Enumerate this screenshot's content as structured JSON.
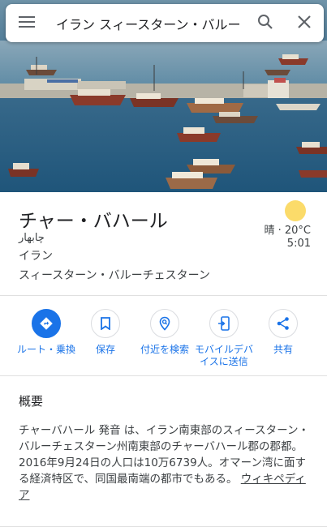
{
  "search": {
    "query": "イラン スィースターン・バルー"
  },
  "place": {
    "title": "チャー・バハール",
    "native_name": "چابهار",
    "country": "イラン",
    "region": "スィースターン・バルーチェスターン"
  },
  "weather": {
    "condition_temp": "晴 · 20°C",
    "time": "5:01",
    "sun_color": "#fbdb6a"
  },
  "actions": [
    {
      "label": "ルート・乗換",
      "icon": "directions-icon"
    },
    {
      "label": "保存",
      "icon": "bookmark-icon"
    },
    {
      "label": "付近を検索",
      "icon": "nearby-icon"
    },
    {
      "label_line1": "モバイルデバ",
      "label_line2": "イスに送信",
      "icon": "send-to-phone-icon"
    },
    {
      "label": "共有",
      "icon": "share-icon"
    }
  ],
  "overview": {
    "heading": "概要",
    "body": "チャーバハール 発音 は、イラン南東部のスィースターン・バルーチェスターン州南東部のチャーバハール郡の郡都。 2016年9月24日の人口は10万6739人。オマーン湾に面する経済特区で、同国最南端の都市でもある。",
    "link": "ウィキペディア"
  },
  "colors": {
    "accent": "#1a73e8",
    "divider": "#e0e0e0"
  }
}
